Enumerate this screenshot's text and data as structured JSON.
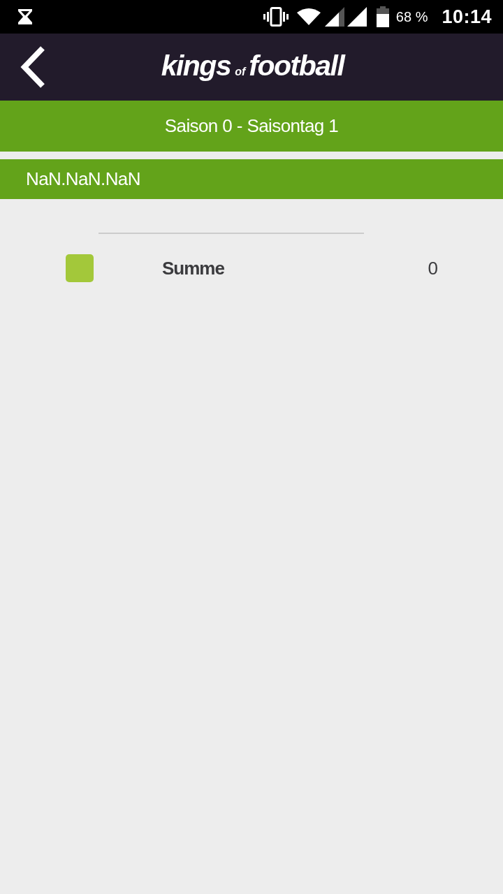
{
  "status_bar": {
    "battery_percent": "68 %",
    "time": "10:14"
  },
  "header": {
    "logo": {
      "words": [
        {
          "text": "kings",
          "kind": "large"
        },
        {
          "text": "of",
          "kind": "small"
        },
        {
          "text": "football",
          "kind": "large"
        }
      ]
    }
  },
  "season_bar": {
    "title": "Saison 0 - Saisontag 1"
  },
  "date_bar": {
    "date": "NaN.NaN.NaN"
  },
  "rows": [
    {
      "color": "#a3c83a",
      "label": "Summe",
      "value": "0"
    }
  ]
}
